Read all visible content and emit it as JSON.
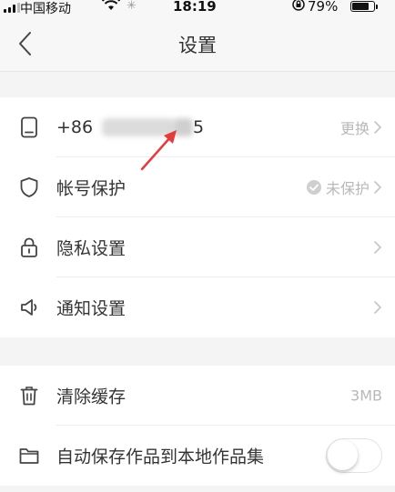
{
  "status_bar": {
    "carrier": "中国移动",
    "time": "18:19",
    "battery_pct": "79%",
    "battery_level": 0.79
  },
  "nav": {
    "title": "设置",
    "back_icon": "chevron-left-icon"
  },
  "group1": [
    {
      "id": "phone",
      "icon": "phone-icon",
      "label": "+86",
      "label_tail": "5",
      "right_text": "更换"
    },
    {
      "id": "account-protect",
      "icon": "shield-icon",
      "label": "帐号保护",
      "right_text": "未保护"
    },
    {
      "id": "privacy",
      "icon": "lock-icon",
      "label": "隐私设置",
      "right_text": ""
    },
    {
      "id": "notification",
      "icon": "speaker-icon",
      "label": "通知设置",
      "right_text": ""
    }
  ],
  "group2": [
    {
      "id": "clear-cache",
      "icon": "trash-icon",
      "label": "清除缓存",
      "right_text": "3MB"
    },
    {
      "id": "auto-save",
      "icon": "folder-icon",
      "label": "自动保存作品到本地作品集",
      "toggle_on": false
    }
  ],
  "colors": {
    "background": "#f4f4f4",
    "annotation_arrow": "#e63b3b",
    "secondary_text": "#b8b8b8"
  }
}
